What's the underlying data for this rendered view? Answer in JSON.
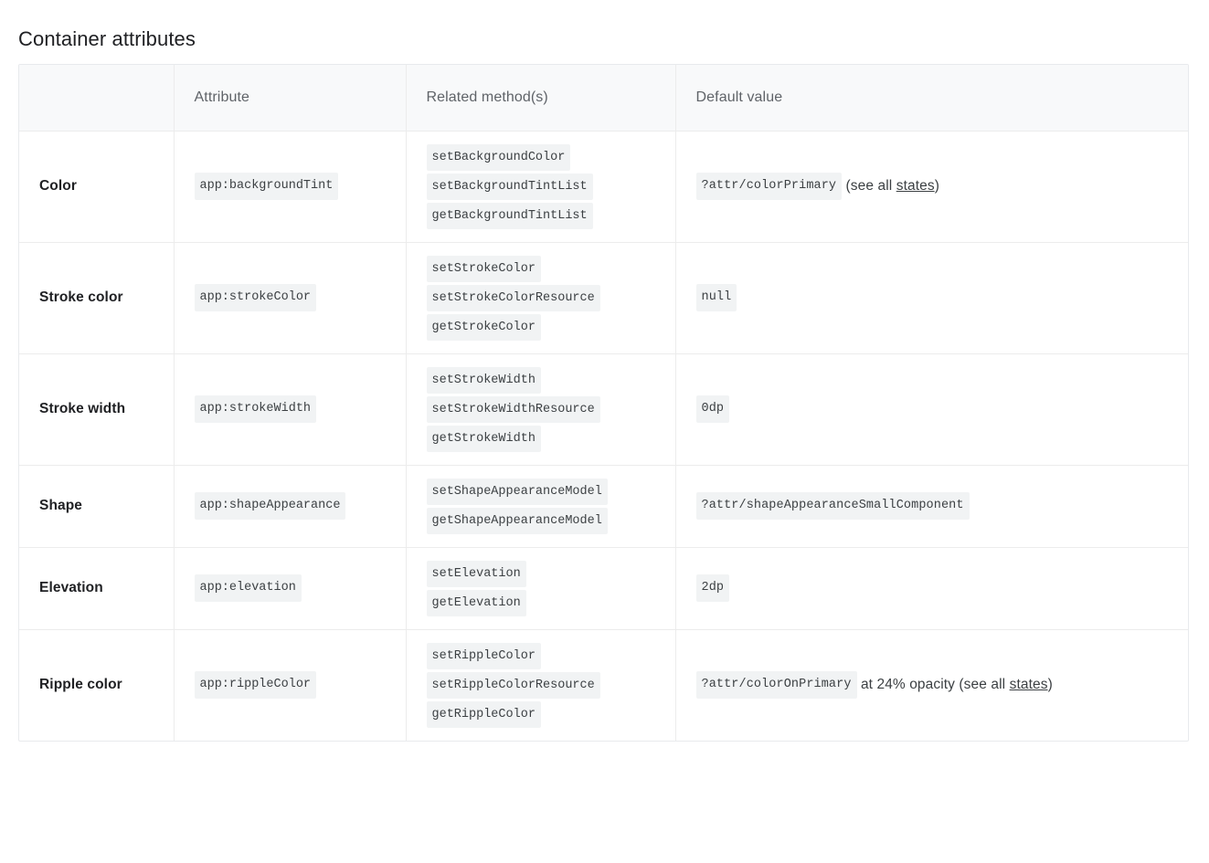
{
  "page": {
    "title": "Container attributes"
  },
  "table": {
    "headers": [
      "",
      "Attribute",
      "Related method(s)",
      "Default value"
    ],
    "rows": [
      {
        "label": "Color",
        "attribute": "app:backgroundTint",
        "methods": [
          "setBackgroundColor",
          "setBackgroundTintList",
          "getBackgroundTintList"
        ],
        "default_code": "?attr/colorPrimary",
        "default_prefix": " (see all ",
        "default_link": "states",
        "default_suffix": ")"
      },
      {
        "label": "Stroke color",
        "attribute": "app:strokeColor",
        "methods": [
          "setStrokeColor",
          "setStrokeColorResource",
          "getStrokeColor"
        ],
        "default_code": "null",
        "default_prefix": "",
        "default_link": "",
        "default_suffix": ""
      },
      {
        "label": "Stroke width",
        "attribute": "app:strokeWidth",
        "methods": [
          "setStrokeWidth",
          "setStrokeWidthResource",
          "getStrokeWidth"
        ],
        "default_code": "0dp",
        "default_prefix": "",
        "default_link": "",
        "default_suffix": ""
      },
      {
        "label": "Shape",
        "attribute": "app:shapeAppearance",
        "methods": [
          "setShapeAppearanceModel",
          "getShapeAppearanceModel"
        ],
        "default_code": "?attr/shapeAppearanceSmallComponent",
        "default_prefix": "",
        "default_link": "",
        "default_suffix": ""
      },
      {
        "label": "Elevation",
        "attribute": "app:elevation",
        "methods": [
          "setElevation",
          "getElevation"
        ],
        "default_code": "2dp",
        "default_prefix": "",
        "default_link": "",
        "default_suffix": ""
      },
      {
        "label": "Ripple color",
        "attribute": "app:rippleColor",
        "methods": [
          "setRippleColor",
          "setRippleColorResource",
          "getRippleColor"
        ],
        "default_code": "?attr/colorOnPrimary",
        "default_prefix": " at 24% opacity (see all ",
        "default_link": "states",
        "default_suffix": ")"
      }
    ]
  },
  "colors": {
    "chip_bg": "#f1f3f4",
    "header_bg": "#f8f9fa",
    "border": "#ececec",
    "text": "#3c4043",
    "heading": "#202124"
  }
}
